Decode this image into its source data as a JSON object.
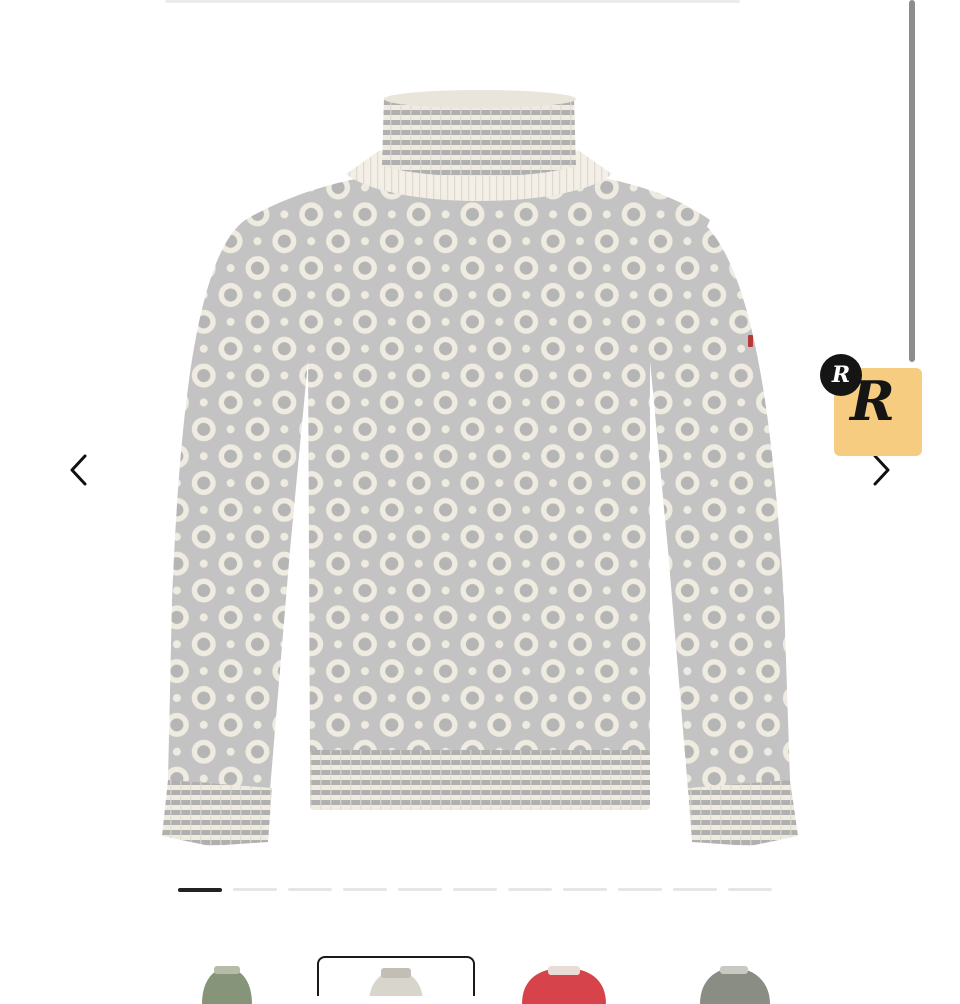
{
  "carousel": {
    "prev_icon": "chevron-left-icon",
    "next_icon": "chevron-right-icon",
    "slide_count": 11,
    "active_slide": 1
  },
  "product": {
    "main_image": "grey-white-norwegian-turtleneck-sweater",
    "colors": {
      "cream": "#efebe1",
      "grey": "#aeaeae",
      "flag_red": "#b53a3a"
    }
  },
  "badge": {
    "small_letter": "R",
    "big_letter": "R",
    "bg_color": "#f6cd80",
    "dot_color": "#151515"
  },
  "thumbnails": [
    {
      "name": "green-variant",
      "color": "#86957a",
      "selected": false
    },
    {
      "name": "grey-variant",
      "color": "#d8d5cd",
      "selected": true
    },
    {
      "name": "red-variant",
      "color": "#d6434a",
      "selected": false
    },
    {
      "name": "dark-grey-variant",
      "color": "#8a8d84",
      "selected": false
    }
  ]
}
